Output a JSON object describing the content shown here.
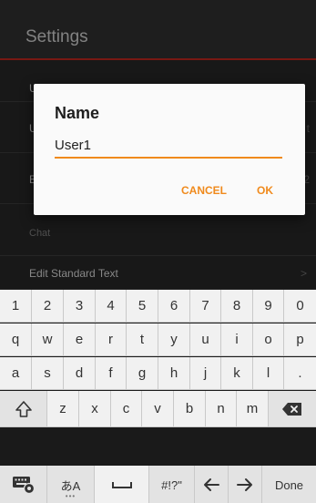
{
  "app": {
    "title": "Settings",
    "rows": [
      {
        "label": "",
        "trail": ""
      },
      {
        "label": "",
        "trail": "t"
      },
      {
        "label": "",
        "trail": "2"
      }
    ],
    "section_chat": "Chat",
    "edit_standard_text": "Edit Standard Text",
    "edit_standard_text_trail": ">",
    "accent_color": "#b8261e"
  },
  "dialog": {
    "title": "Name",
    "input_value": "User1",
    "cancel_label": "CANCEL",
    "ok_label": "OK",
    "accent_color": "#f08a1c"
  },
  "keyboard": {
    "row_numbers": [
      "1",
      "2",
      "3",
      "4",
      "5",
      "6",
      "7",
      "8",
      "9",
      "0"
    ],
    "row_q": [
      "q",
      "w",
      "e",
      "r",
      "t",
      "y",
      "u",
      "i",
      "o",
      "p"
    ],
    "row_a": [
      "a",
      "s",
      "d",
      "f",
      "g",
      "h",
      "j",
      "k",
      "l",
      "."
    ],
    "row_z": [
      "z",
      "x",
      "c",
      "v",
      "b",
      "n",
      "m"
    ],
    "lang_label": "あA",
    "symbols_label": "#!?\"",
    "done_label": "Done",
    "icons": {
      "shift": "shift-icon",
      "backspace": "backspace-icon",
      "settings": "keyboard-settings-icon",
      "space": "space-icon",
      "left": "arrow-left-icon",
      "right": "arrow-right-icon"
    }
  }
}
